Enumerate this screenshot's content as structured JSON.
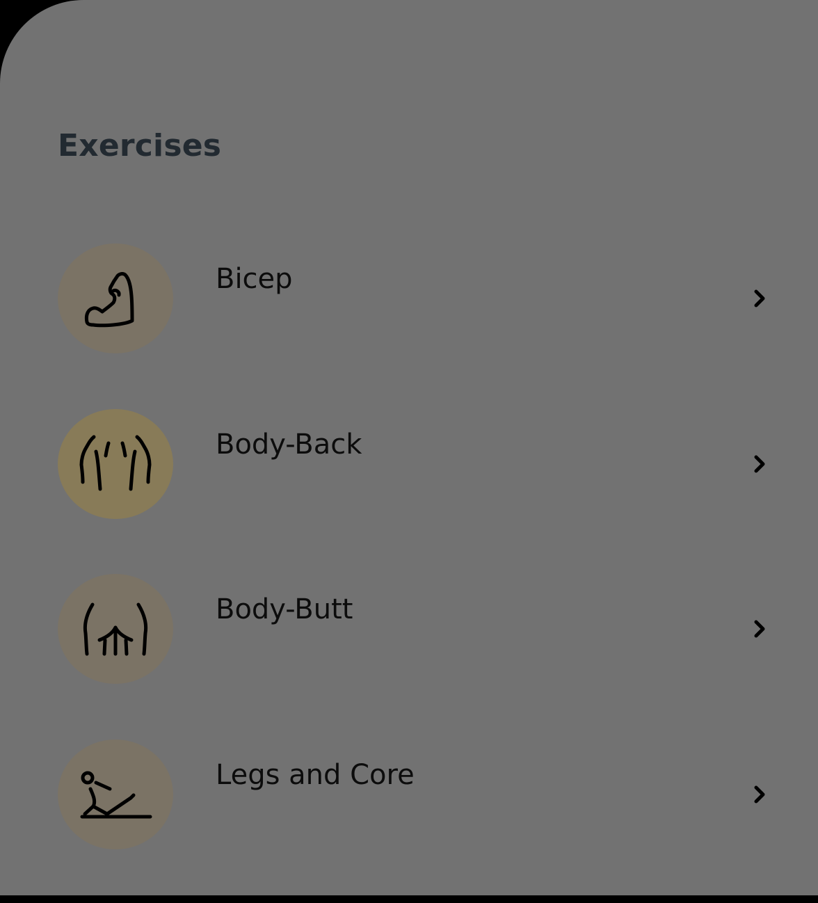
{
  "section": {
    "title": "Exercises"
  },
  "exercises": [
    {
      "label": "Bicep",
      "icon": "flexed-bicep-icon",
      "highlighted": false
    },
    {
      "label": "Body-Back",
      "icon": "back-muscles-icon",
      "highlighted": true
    },
    {
      "label": "Body-Butt",
      "icon": "glutes-icon",
      "highlighted": false
    },
    {
      "label": "Legs and Core",
      "icon": "seated-leg-raise-icon",
      "highlighted": false
    }
  ],
  "colors": {
    "background": "#727272",
    "title": "#222a31",
    "icon_circle": "#7b7365",
    "icon_circle_highlighted": "#887b58",
    "text": "#0c0c0c"
  }
}
